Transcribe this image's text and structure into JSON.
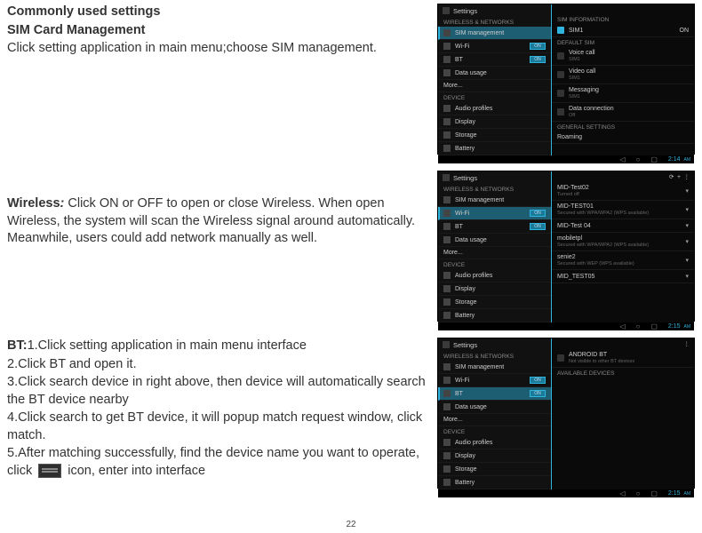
{
  "doc": {
    "heading_commonly": "Commonly used settings",
    "heading_sim": "SIM Card Management",
    "sim_body": "Click setting application in main menu;choose SIM management.",
    "wireless_label": "Wireless",
    "wireless_colon": ": ",
    "wireless_body": "Click ON or OFF to open or close Wireless. When open Wireless, the system will scan the Wireless signal around automatically. Meanwhile, users could add network manually as well.",
    "bt_label": "BT:",
    "bt_1": "1.Click setting application in main menu interface",
    "bt_2": "2.Click BT and open it.",
    "bt_3": "3.Click search device in right above, then device will automatically search the BT device nearby",
    "bt_4": "4.Click search to get BT device, it will popup match request window, click match.",
    "bt_5a": "5.After matching successfully, find the device name you want to operate, click ",
    "bt_5b": " icon, enter into interface",
    "page_number": "22"
  },
  "shot1": {
    "title": "Settings",
    "left_cat1": "WIRELESS & NETWORKS",
    "left_items": [
      "SIM management",
      "Wi-Fi",
      "BT",
      "Data usage",
      "More..."
    ],
    "left_cat2": "DEVICE",
    "left_items2": [
      "Audio profiles",
      "Display",
      "Storage",
      "Battery"
    ],
    "on": "ON",
    "right_cat1": "SIM INFORMATION",
    "right_sim": "SIM1",
    "right_cat2": "DEFAULT SIM",
    "right_items": [
      "Voice call",
      "Video call",
      "Messaging",
      "Data connection"
    ],
    "right_cat3": "GENERAL SETTINGS",
    "right_item_roaming": "Roaming",
    "time": "2:14",
    "ampm": "AM"
  },
  "shot2": {
    "title": "Settings",
    "left_cat1": "WIRELESS & NETWORKS",
    "left_items": [
      "SIM management",
      "Wi-Fi",
      "BT",
      "Data usage",
      "More..."
    ],
    "left_cat2": "DEVICE",
    "left_items2": [
      "Audio profiles",
      "Display",
      "Storage",
      "Battery"
    ],
    "on": "ON",
    "right_items": [
      "MID-Test02",
      "MID-TEST01",
      "MID-Test 04",
      "mobiletpl",
      "senie2",
      "MID_TEST05"
    ],
    "right_sub_secured": "Secured with WPA/WPA2 (WPS available)",
    "right_sub_turned": "Turned off",
    "time": "2:15",
    "ampm": "AM"
  },
  "shot3": {
    "title": "Settings",
    "left_cat1": "WIRELESS & NETWORKS",
    "left_items": [
      "SIM management",
      "Wi-Fi",
      "BT",
      "Data usage",
      "More..."
    ],
    "left_cat2": "DEVICE",
    "left_items2": [
      "Audio profiles",
      "Display",
      "Storage",
      "Battery"
    ],
    "on": "ON",
    "right_device": "ANDROID BT",
    "right_device_sub": "Not visible to other BT devices",
    "right_cat": "AVAILABLE DEVICES",
    "time": "2:15",
    "ampm": "AM"
  }
}
